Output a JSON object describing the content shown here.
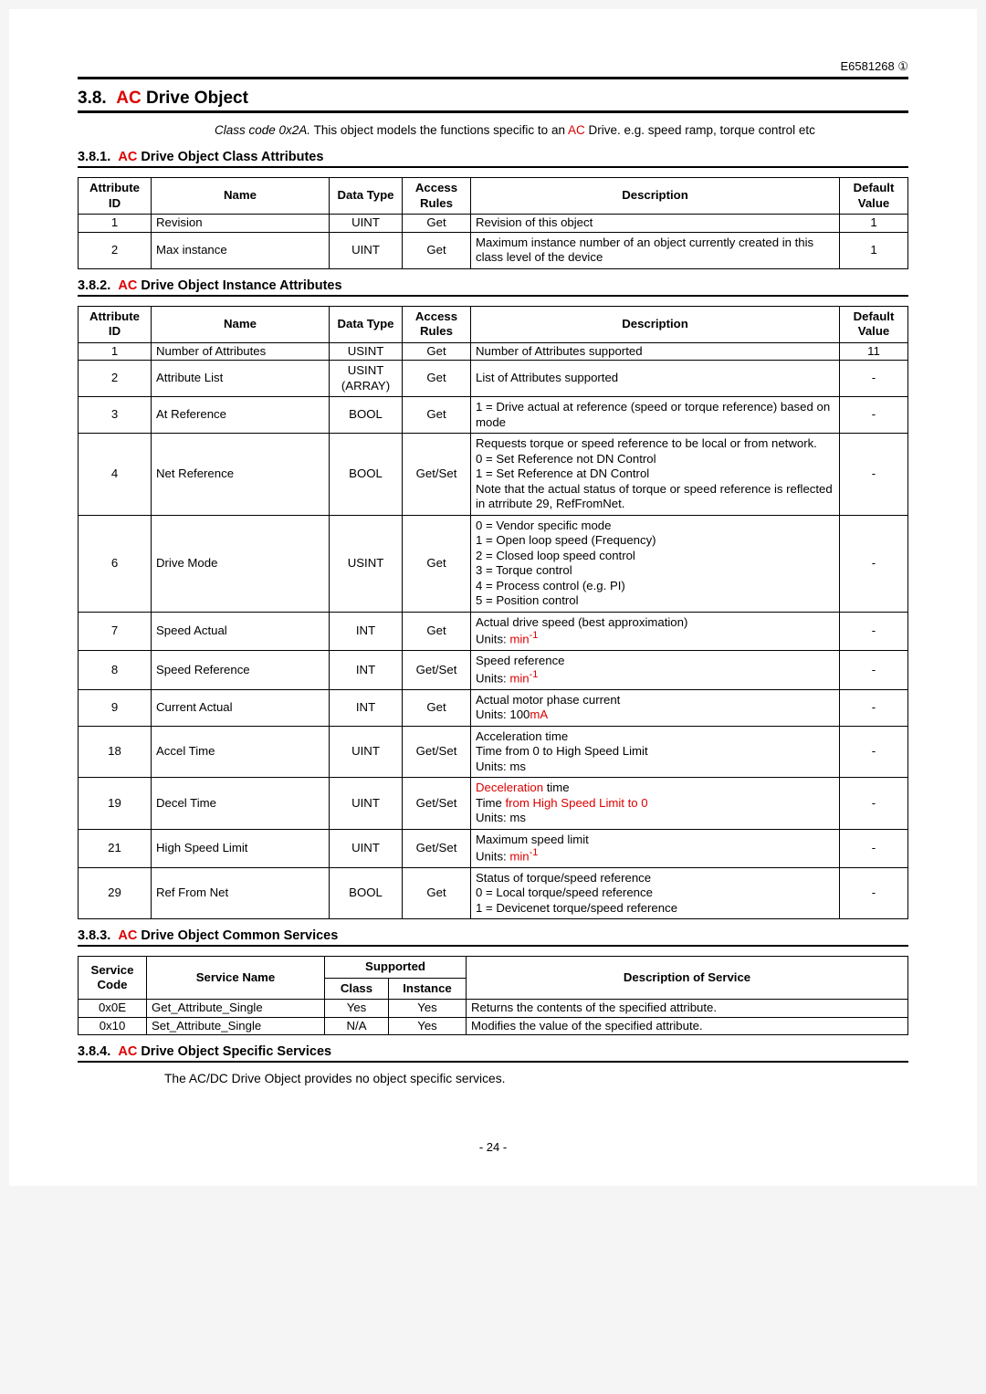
{
  "header": {
    "doc_id": "E6581268 ①"
  },
  "section": {
    "num": "3.8.",
    "ac": "AC",
    "title_rest": " Drive Object",
    "body_pre": "Class code 0x2A.",
    "body_mid1": " This object models the functions specific to an ",
    "body_ac": "AC",
    "body_mid2": " Drive. e.g. speed ramp, torque control etc"
  },
  "sub381": {
    "num": "3.8.1.",
    "ac": "AC",
    "rest": " Drive Object Class Attributes"
  },
  "t381_head": {
    "c1": "Attribute ID",
    "c2": "Name",
    "c3": "Data Type",
    "c4": "Access Rules",
    "c5": "Description",
    "c6": "Default Value"
  },
  "t381": [
    {
      "id": "1",
      "name": "Revision",
      "dt": "UINT",
      "ar": "Get",
      "desc": "Revision of this object",
      "dv": "1"
    },
    {
      "id": "2",
      "name": "Max instance",
      "dt": "UINT",
      "ar": "Get",
      "desc": "Maximum instance number of an object currently created in this class level of the device",
      "dv": "1"
    }
  ],
  "sub382": {
    "num": "3.8.2.",
    "ac": "AC",
    "rest": " Drive Object Instance Attributes"
  },
  "t382_head": {
    "c1": "Attribute ID",
    "c2": "Name",
    "c3": "Data Type",
    "c4": "Access Rules",
    "c5": "Description",
    "c6": "Default Value"
  },
  "t382": {
    "r1": {
      "id": "1",
      "name": "Number of Attributes",
      "dt": "USINT",
      "ar": "Get",
      "desc": "Number of Attributes supported",
      "dv": "11"
    },
    "r2": {
      "id": "2",
      "name": "Attribute List",
      "dt": "USINT (ARRAY)",
      "ar": "Get",
      "desc": "List of Attributes supported",
      "dv": "-"
    },
    "r3": {
      "id": "3",
      "name": "At Reference",
      "dt": "BOOL",
      "ar": "Get",
      "desc": "1 = Drive actual at reference (speed or torque reference) based on mode",
      "dv": "-"
    },
    "r4": {
      "id": "4",
      "name": "Net Reference",
      "dt": "BOOL",
      "ar": "Get/Set",
      "desc": "Requests torque or speed reference to be local or from network.\n0 = Set Reference not DN Control\n1 = Set Reference at DN Control\nNote that the actual status of torque or speed reference is reflected in atrribute 29, RefFromNet.",
      "dv": "-"
    },
    "r6": {
      "id": "6",
      "name": "Drive Mode",
      "dt": "USINT",
      "ar": "Get",
      "desc": "0 = Vendor specific mode\n1 = Open loop speed (Frequency)\n2 = Closed loop speed control\n3 = Torque control\n4 = Process control (e.g. PI)\n5 = Position control",
      "dv": "-"
    },
    "r7": {
      "id": "7",
      "name": "Speed Actual",
      "dt": "INT",
      "ar": "Get",
      "desc_a": "Actual drive speed (best approximation)",
      "desc_b_pre": "Units: ",
      "unit": "min",
      "dv": "-"
    },
    "r8": {
      "id": "8",
      "name": "Speed Reference",
      "dt": "INT",
      "ar": "Get/Set",
      "desc_a": "Speed reference",
      "desc_b_pre": "Units: ",
      "unit": "min",
      "dv": "-"
    },
    "r9": {
      "id": "9",
      "name": "Current Actual",
      "dt": "INT",
      "ar": "Get",
      "desc_a": "Actual motor phase current",
      "desc_b_pre": "Units: 100",
      "unit": "mA",
      "dv": "-"
    },
    "r18": {
      "id": "18",
      "name": "Accel Time",
      "dt": "UINT",
      "ar": "Get/Set",
      "desc_a": "Acceleration time",
      "desc_b": "Time from 0 to High Speed Limit",
      "desc_c": "Units: ms",
      "dv": "-"
    },
    "r19": {
      "id": "19",
      "name": "Decel Time",
      "dt": "UINT",
      "ar": "Get/Set",
      "desc_a_red": "Deceleration",
      "desc_a_rest": " time",
      "desc_b_pre": "Time ",
      "desc_b_red": "from High Speed Limit to 0",
      "desc_c": "Units: ms",
      "dv": "-"
    },
    "r21": {
      "id": "21",
      "name": "High Speed Limit",
      "dt": "UINT",
      "ar": "Get/Set",
      "desc_a": "Maximum speed limit",
      "desc_b_pre": "Units: ",
      "unit": "min",
      "dv": "-"
    },
    "r29": {
      "id": "29",
      "name": "Ref From Net",
      "dt": "BOOL",
      "ar": "Get",
      "desc": "Status of torque/speed reference\n0 = Local torque/speed reference\n1 = Devicenet torque/speed reference",
      "dv": "-"
    }
  },
  "sub383": {
    "num": "3.8.3.",
    "ac": "AC",
    "rest": " Drive Object Common Services"
  },
  "t383_head": {
    "c1": "Service Code",
    "c2": "Service Name",
    "sup": "Supported",
    "c3": "Class",
    "c4": "Instance",
    "c5": "Description of Service"
  },
  "t383": [
    {
      "code": "0x0E",
      "name": "Get_Attribute_Single",
      "cls": "Yes",
      "inst": "Yes",
      "desc": "Returns the contents of the specified attribute."
    },
    {
      "code": "0x10",
      "name": "Set_Attribute_Single",
      "cls": "N/A",
      "inst": "Yes",
      "desc": "Modifies the value of the specified attribute."
    }
  ],
  "sub384": {
    "num": "3.8.4.",
    "ac": "AC",
    "rest": " Drive Object Specific Services"
  },
  "text384": "The AC/DC Drive Object provides no object specific services.",
  "footer": {
    "page": "- 24 -"
  }
}
